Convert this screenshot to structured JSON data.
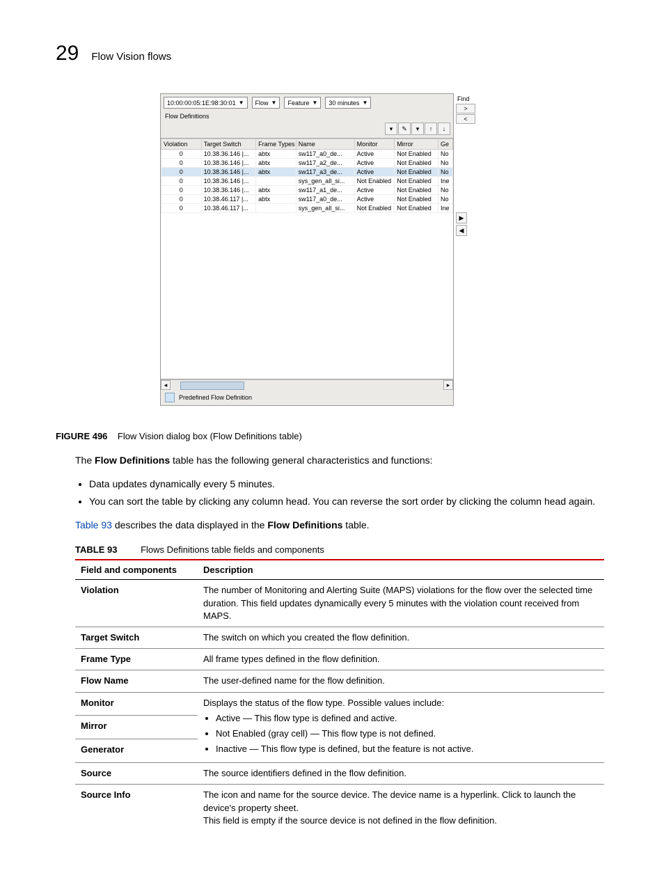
{
  "header": {
    "page_number": "29",
    "title": "Flow Vision flows"
  },
  "dialog": {
    "find_label": "Find",
    "combo1": "10:00:00:05:1E:98:30:01",
    "combo2": "Flow",
    "combo3": "Feature",
    "combo4": "30 minutes",
    "section_title": "Flow Definitions",
    "columns": [
      "Violation",
      "Target Switch",
      "Frame Types",
      "Name",
      "Monitor",
      "Mirror",
      "Ge"
    ],
    "rows": [
      {
        "violation": "0",
        "target": "10.38.36.146 |...",
        "frame": "abtx",
        "name": "sw117_a0_de...",
        "monitor": "Active",
        "mirror": "Not Enabled",
        "ge": "No",
        "sel": false
      },
      {
        "violation": "0",
        "target": "10.38.36.146 |...",
        "frame": "abtx",
        "name": "sw117_a2_de...",
        "monitor": "Active",
        "mirror": "Not Enabled",
        "ge": "No",
        "sel": false
      },
      {
        "violation": "0",
        "target": "10.38.36.146 |...",
        "frame": "abtx",
        "name": "sw117_a3_de...",
        "monitor": "Active",
        "mirror": "Not Enabled",
        "ge": "No",
        "sel": true
      },
      {
        "violation": "0",
        "target": "10.38.36.146 |...",
        "frame": "",
        "name": "sys_gen_all_si...",
        "monitor": "Not Enabled",
        "mirror": "Not Enabled",
        "ge": "Ine",
        "sel": false
      },
      {
        "violation": "0",
        "target": "10.38.36.146 |...",
        "frame": "abtx",
        "name": "sw117_a1_de...",
        "monitor": "Active",
        "mirror": "Not Enabled",
        "ge": "No",
        "sel": false
      },
      {
        "violation": "0",
        "target": "10.38.46.117 |...",
        "frame": "abtx",
        "name": "sw117_a0_de...",
        "monitor": "Active",
        "mirror": "Not Enabled",
        "ge": "No",
        "sel": false
      },
      {
        "violation": "0",
        "target": "10.38.46.117 |...",
        "frame": "",
        "name": "sys_gen_all_si...",
        "monitor": "Not Enabled",
        "mirror": "Not Enabled",
        "ge": "Ine",
        "sel": false
      }
    ],
    "legend": "Predefined Flow Definition"
  },
  "figure_caption": {
    "num": "FIGURE 496",
    "text": "Flow Vision dialog box (Flow Definitions table)"
  },
  "intro": {
    "prefix": "The ",
    "bold": "Flow Definitions",
    "suffix": " table has the following general characteristics and functions:"
  },
  "bullets": [
    "Data updates dynamically every 5 minutes.",
    "You can sort the table by clicking any column head. You can reverse the sort order by clicking the column head again."
  ],
  "xref_para": {
    "link": "Table 93",
    "mid": " describes the data displayed in the ",
    "bold": "Flow Definitions",
    "suffix": " table."
  },
  "table93": {
    "num": "TABLE 93",
    "title": "Flows Definitions table fields and components",
    "header": [
      "Field and components",
      "Description"
    ],
    "rows": [
      {
        "field": "Violation",
        "desc": "The number of Monitoring and Alerting Suite (MAPS) violations for the flow over the selected time duration. This field updates dynamically every 5 minutes with the violation count received from MAPS."
      },
      {
        "field": "Target Switch",
        "desc": "The switch on which you created the flow definition."
      },
      {
        "field": "Frame Type",
        "desc": "All frame types defined in the flow definition."
      },
      {
        "field": "Flow Name",
        "desc": "The user-defined name for the flow definition."
      }
    ],
    "monitor_group": {
      "fields": [
        "Monitor",
        "Mirror",
        "Generator"
      ],
      "lead": "Displays the status of the flow type. Possible values include:",
      "items": [
        "Active — This flow type is defined and active.",
        "Not Enabled (gray cell) — This flow type is not defined.",
        "Inactive — This flow type is defined, but the feature is not active."
      ]
    },
    "rows_after": [
      {
        "field": "Source",
        "desc": "The source identifiers defined in the flow definition."
      },
      {
        "field": "Source Info",
        "desc": "The icon and name for the source device. The device name is a hyperlink. Click to launch the device's property sheet.\nThis field is empty if the source device is not defined in the flow definition."
      }
    ]
  }
}
